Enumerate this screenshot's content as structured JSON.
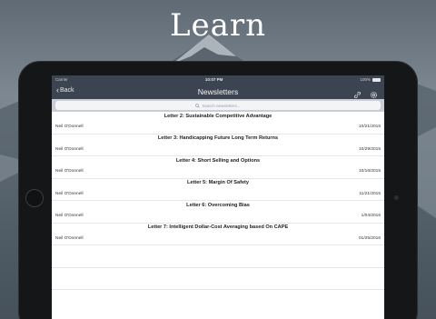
{
  "headline": "Learn",
  "statusbar": {
    "carrier": "Carrier",
    "time": "10:07 PM",
    "battery": "100%"
  },
  "navbar": {
    "back_label": "Back",
    "title": "Newsletters"
  },
  "search": {
    "placeholder": "Search newsletters..."
  },
  "letters": [
    {
      "title": "Letter 2: Sustainable Competitive Advantage",
      "author": "Neil O'Donnell",
      "date": "10/21/2015"
    },
    {
      "title": "Letter 3: Handicapping Future Long Term Returns",
      "author": "Neil O'Donnell",
      "date": "10/29/2015"
    },
    {
      "title": "Letter 4: Short Selling and Options",
      "author": "Neil O'Donnell",
      "date": "10/16/2015"
    },
    {
      "title": "Letter 5: Margin Of Safety",
      "author": "Neil O'Donnell",
      "date": "11/21/2015"
    },
    {
      "title": "Letter 6: Overcoming Bias",
      "author": "Neil O'Donnell",
      "date": "1/04/2016"
    },
    {
      "title": "Letter 7: Intelligent Dollar-Cost Averaging based On CAPE",
      "author": "Neil O'Donnell",
      "date": "01/25/2016"
    }
  ],
  "colors": {
    "navbar": "#3d4451",
    "search_bar": "#c9ced6"
  },
  "icons": {
    "link": "link-icon",
    "settings": "gear-icon",
    "search": "search-icon",
    "back": "chevron-left-icon"
  }
}
